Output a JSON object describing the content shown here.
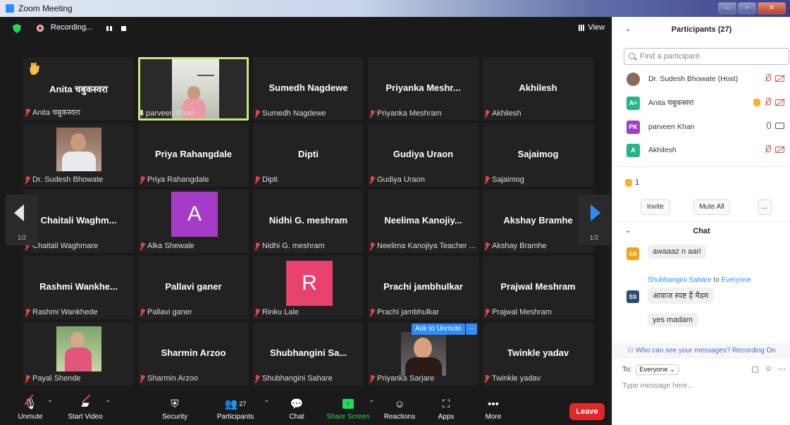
{
  "window": {
    "title": "Zoom Meeting"
  },
  "topbar": {
    "recording_label": "Recording...",
    "view_label": "View"
  },
  "tiles": [
    {
      "name": "Anita चबुकस्वरा",
      "label": "Anita चबुकस्वरा"
    },
    {
      "name": "",
      "label": "parveen Khan"
    },
    {
      "name": "Sumedh Nagdewe",
      "label": "Sumedh Nagdewe"
    },
    {
      "name": "Priyanka  Meshr...",
      "label": "Priyanka Meshram"
    },
    {
      "name": "Akhilesh",
      "label": "Akhilesh"
    },
    {
      "name": "",
      "label": "Dr. Sudesh Bhowate"
    },
    {
      "name": "Priya Rahangdale",
      "label": "Priya Rahangdale"
    },
    {
      "name": "Dipti",
      "label": "Dipti"
    },
    {
      "name": "Gudiya Uraon",
      "label": "Gudiya Uraon"
    },
    {
      "name": "Sajaimog",
      "label": "Sajaimog"
    },
    {
      "name": "Chaitali  Waghm...",
      "label": "Chaitali Waghmare"
    },
    {
      "name": "",
      "label": "Alka Shewale",
      "avatar": "A"
    },
    {
      "name": "Nidhi G. meshram",
      "label": "Nidhi G. meshram"
    },
    {
      "name": "Neelima  Kanojiy...",
      "label": "Neelima Kanojiya Teacher ..."
    },
    {
      "name": "Akshay Bramhe",
      "label": "Akshay Bramhe"
    },
    {
      "name": "Rashmi  Wankhe...",
      "label": "Rashmi Wankhede"
    },
    {
      "name": "Pallavi ganer",
      "label": "Pallavi ganer"
    },
    {
      "name": "",
      "label": "Rinku Lale",
      "avatar": "R"
    },
    {
      "name": "Prachi jambhulkar",
      "label": "Prachi jambhulkar"
    },
    {
      "name": "Prajwal Meshram",
      "label": "Prajwal Meshram"
    },
    {
      "name": "",
      "label": "Payal Shende"
    },
    {
      "name": "Sharmin Arzoo",
      "label": "Sharmin Arzoo"
    },
    {
      "name": "Shubhangini  Sa...",
      "label": "Shubhangini Sahare"
    },
    {
      "name": "",
      "label": "Priyanka Sarjare"
    },
    {
      "name": "Twinkle yadav",
      "label": "Twinkle yadav"
    }
  ],
  "tile_overlay": {
    "ask_unmute": "Ask to Unmute",
    "more": "..."
  },
  "pagination": {
    "left": "1/2",
    "right": "1/2"
  },
  "toolbar": {
    "unmute": "Unmute",
    "start_video": "Start Video",
    "security": "Security",
    "participants": "Participants",
    "participants_count": "27",
    "chat": "Chat",
    "share_screen": "Share Screen",
    "reactions": "Reactions",
    "apps": "Apps",
    "more": "More",
    "leave": "Leave"
  },
  "participants_panel": {
    "title": "Participants (27)",
    "search_placeholder": "Find a participant",
    "rows": [
      {
        "initials": "",
        "name": "Dr. Sudesh Bhowate (Host)",
        "color": "#8a6a58"
      },
      {
        "initials": "A≈",
        "name": "Anita चबुकस्वरा",
        "color": "#26b38a"
      },
      {
        "initials": "PK",
        "name": "parveen Khan",
        "color": "#9b3fc4"
      },
      {
        "initials": "A",
        "name": "Akhilesh",
        "color": "#26b38a"
      }
    ],
    "raised_hands": "1",
    "invite": "Invite",
    "mute_all": "Mute All",
    "more": "..."
  },
  "chat_panel": {
    "title": "Chat",
    "messages": [
      {
        "avatar": "SA",
        "avatar_color": "#f7a21b",
        "text": "awaaaz n aari"
      },
      {
        "avatar": "SS",
        "avatar_color": "#2f4e6e",
        "text": "आवाज स्पष्ट हैं मैडम"
      },
      {
        "text": "yes madam"
      }
    ],
    "sender": "Shubhangini Sahare",
    "to_word": "to",
    "recipient": "Everyone",
    "visibility_note": "Who can see your messages? Recording On",
    "to_label": "To:",
    "to_select": "Everyone",
    "input_placeholder": "Type message here..."
  }
}
